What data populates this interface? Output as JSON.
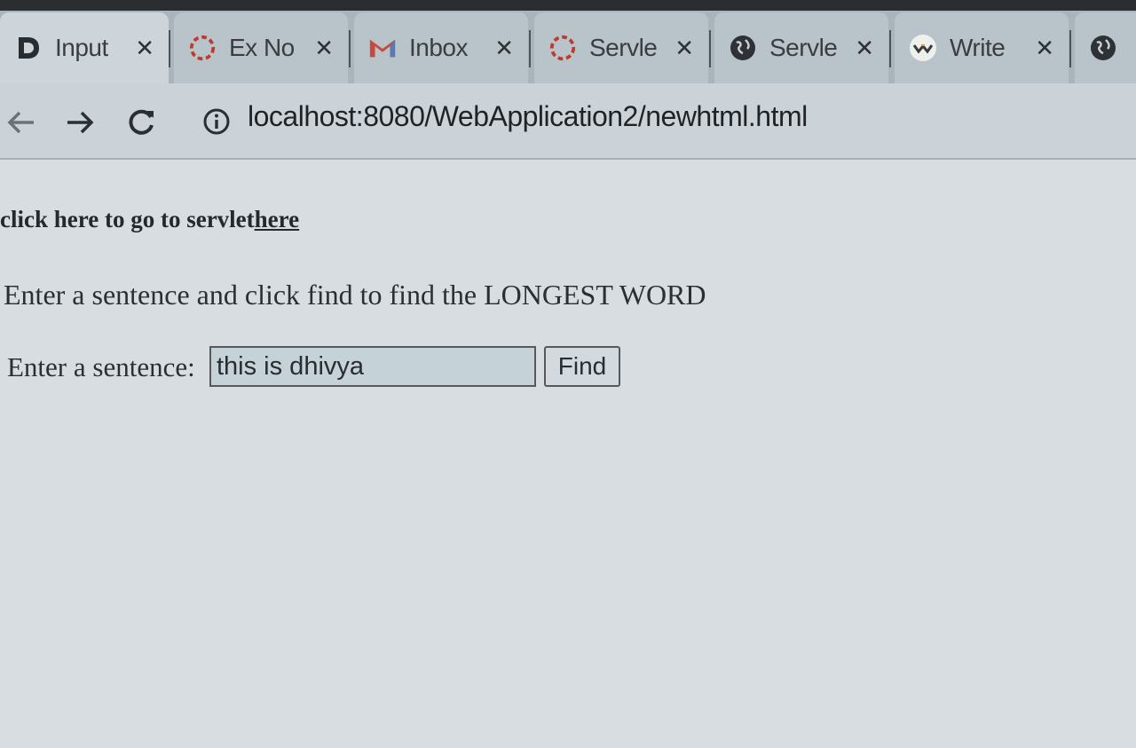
{
  "browser": {
    "tabs": [
      {
        "label": "Input",
        "icon": "d-letter-icon",
        "close": "✕"
      },
      {
        "label": "Ex No",
        "icon": "spinner-icon",
        "close": "✕"
      },
      {
        "label": "Inbox",
        "icon": "gmail-icon",
        "close": "✕"
      },
      {
        "label": "Servle",
        "icon": "spinner-icon",
        "close": "✕"
      },
      {
        "label": "Servle",
        "icon": "globe-icon",
        "close": "✕"
      },
      {
        "label": "Write",
        "icon": "write-logo-icon",
        "close": "✕"
      }
    ],
    "address": {
      "url": "localhost:8080/WebApplication2/newhtml.html"
    }
  },
  "page": {
    "servlet_text": "click here to go to servlet",
    "servlet_link": "here",
    "instruction": "Enter a sentence and click find to find the LONGEST WORD",
    "form": {
      "label": "Enter a sentence:",
      "input_value": "this is dhivya",
      "button_label": "Find"
    }
  }
}
